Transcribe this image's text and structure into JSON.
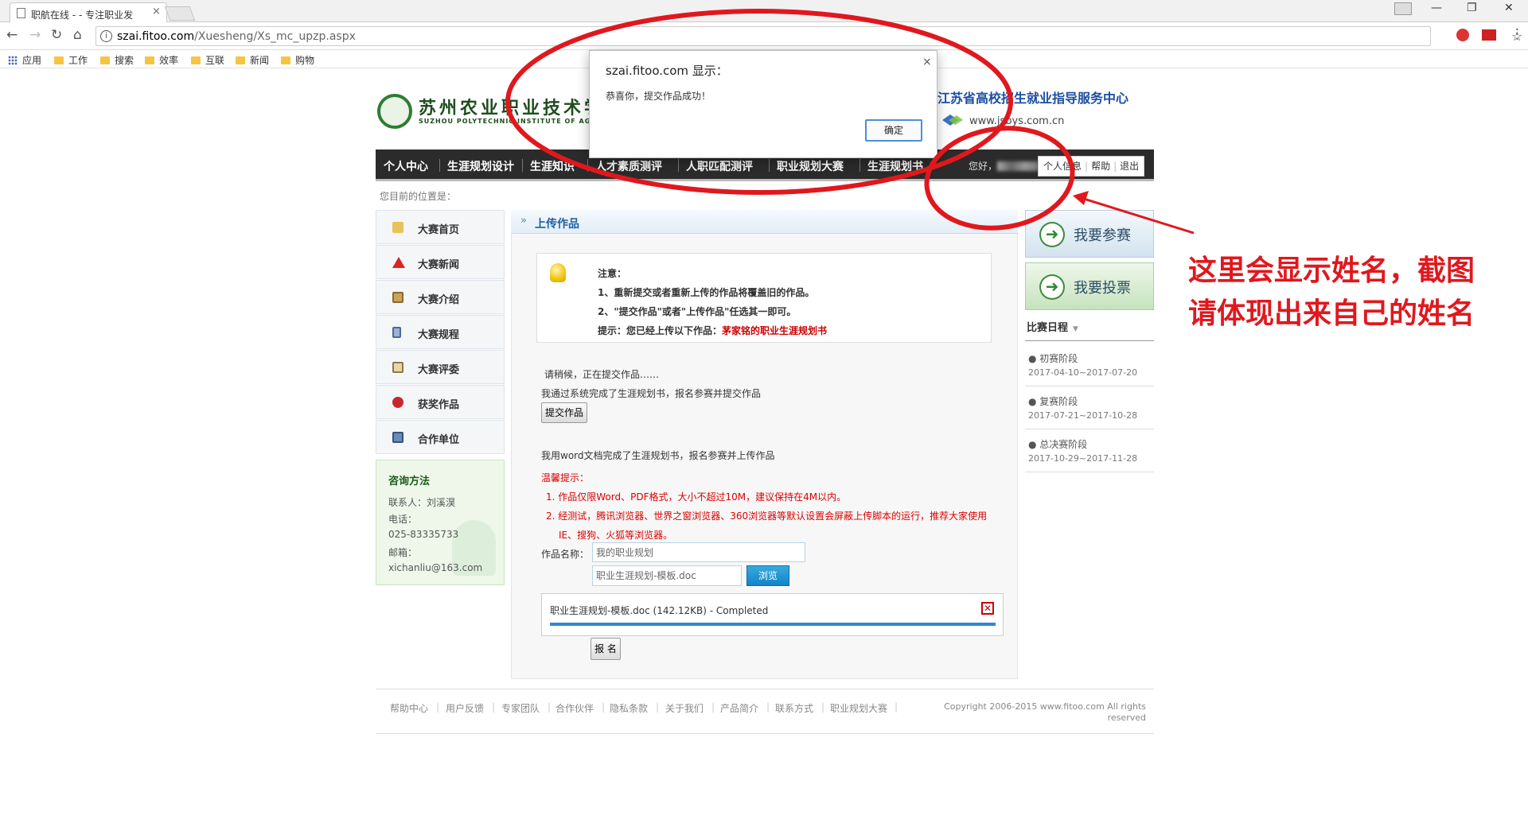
{
  "browser": {
    "tab_title": "职航在线 - - 专注职业发",
    "url_host": "szai.fitoo.com",
    "url_path": "/Xuesheng/Xs_mc_upzp.aspx",
    "bookmarks": [
      "应用",
      "工作",
      "搜索",
      "效率",
      "互联",
      "新闻",
      "购物"
    ]
  },
  "header": {
    "school_name": "苏州农业职业技术学",
    "school_name_en": "SUZHOU POLYTECHNIC INSTITUTE OF AGRICUL",
    "partner_title": "江苏省高校招生就业指导服务中心",
    "partner_url": "www.jsbys.com.cn"
  },
  "nav": {
    "items": [
      "个人中心",
      "生涯规划设计",
      "生涯知识",
      "人才素质测评",
      "人职匹配测评",
      "职业规划大赛",
      "生涯规划书"
    ],
    "hello": "您好，",
    "user_links": [
      "个人信息",
      "帮助",
      "退出"
    ]
  },
  "breadcrumb": "您目前的位置是：",
  "sidebar": {
    "items": [
      "大赛首页",
      "大赛新闻",
      "大赛介绍",
      "大赛规程",
      "大赛评委",
      "获奖作品",
      "合作单位"
    ],
    "contact": {
      "title": "咨询方法",
      "person": "联系人：刘溪淏",
      "phone_label": "电话：",
      "phone": "025-83335733",
      "email_label": "邮箱：",
      "email": "xichanliu@163.com"
    }
  },
  "main": {
    "section_title": "上传作品",
    "notice": {
      "title": "注意：",
      "line1": "1、重新提交或者重新上传的作品将覆盖旧的作品。",
      "line2": "2、\"提交作品\"或者\"上传作品\"任选其一即可。",
      "hint_prefix": "提示：您已经上传以下作品：",
      "hint_work": "茅家铭的职业生涯规划书"
    },
    "waiting_text": "请稍候，正在提交作品……",
    "system_text": "我通过系统完成了生涯规划书，报名参赛并提交作品",
    "submit_button": "提交作品",
    "word_text": "我用word文档完成了生涯规划书，报名参赛并上传作品",
    "tips_title": "温馨提示：",
    "tip1": "1. 作品仅限Word、PDF格式，大小不超过10M，建议保持在4M以内。",
    "tip2a": "2. 经测试，腾讯浏览器、世界之窗浏览器、360浏览器等默认设置会屏蔽上传脚本的运行，推荐大家使用",
    "tip2b": "IE、搜狗、火狐等浏览器。",
    "name_label": "作品名称：",
    "name_value": "我的职业规划",
    "file_value": "职业生涯规划-模板.doc",
    "browse_button": "浏览",
    "upload_status": "职业生涯规划-模板.doc (142.12KB) - Completed",
    "upload_progress": 1.0,
    "signup_button": "报 名"
  },
  "right": {
    "join_button": "我要参赛",
    "vote_button": "我要投票",
    "schedule_title": "比赛日程",
    "stages": [
      {
        "name": "初赛阶段",
        "dates": "2017-04-10~2017-07-20"
      },
      {
        "name": "复赛阶段",
        "dates": "2017-07-21~2017-10-28"
      },
      {
        "name": "总决赛阶段",
        "dates": "2017-10-29~2017-11-28"
      }
    ]
  },
  "footer": {
    "links": [
      "帮助中心",
      "用户反馈",
      "专家团队",
      "合作伙伴",
      "隐私条款",
      "关于我们",
      "产品简介",
      "联系方式",
      "职业规划大赛"
    ],
    "copyright1": "Copyright 2006-2015 www.fitoo.com All rights",
    "copyright2": "reserved"
  },
  "dialog": {
    "title": "szai.fitoo.com 显示：",
    "message": "恭喜你，提交作品成功！",
    "ok_button": "确定",
    "close": "×"
  },
  "annotation": {
    "line1": "这里会显示姓名，截图",
    "line2": "请体现出来自己的姓名",
    "color": "#e0181e"
  }
}
